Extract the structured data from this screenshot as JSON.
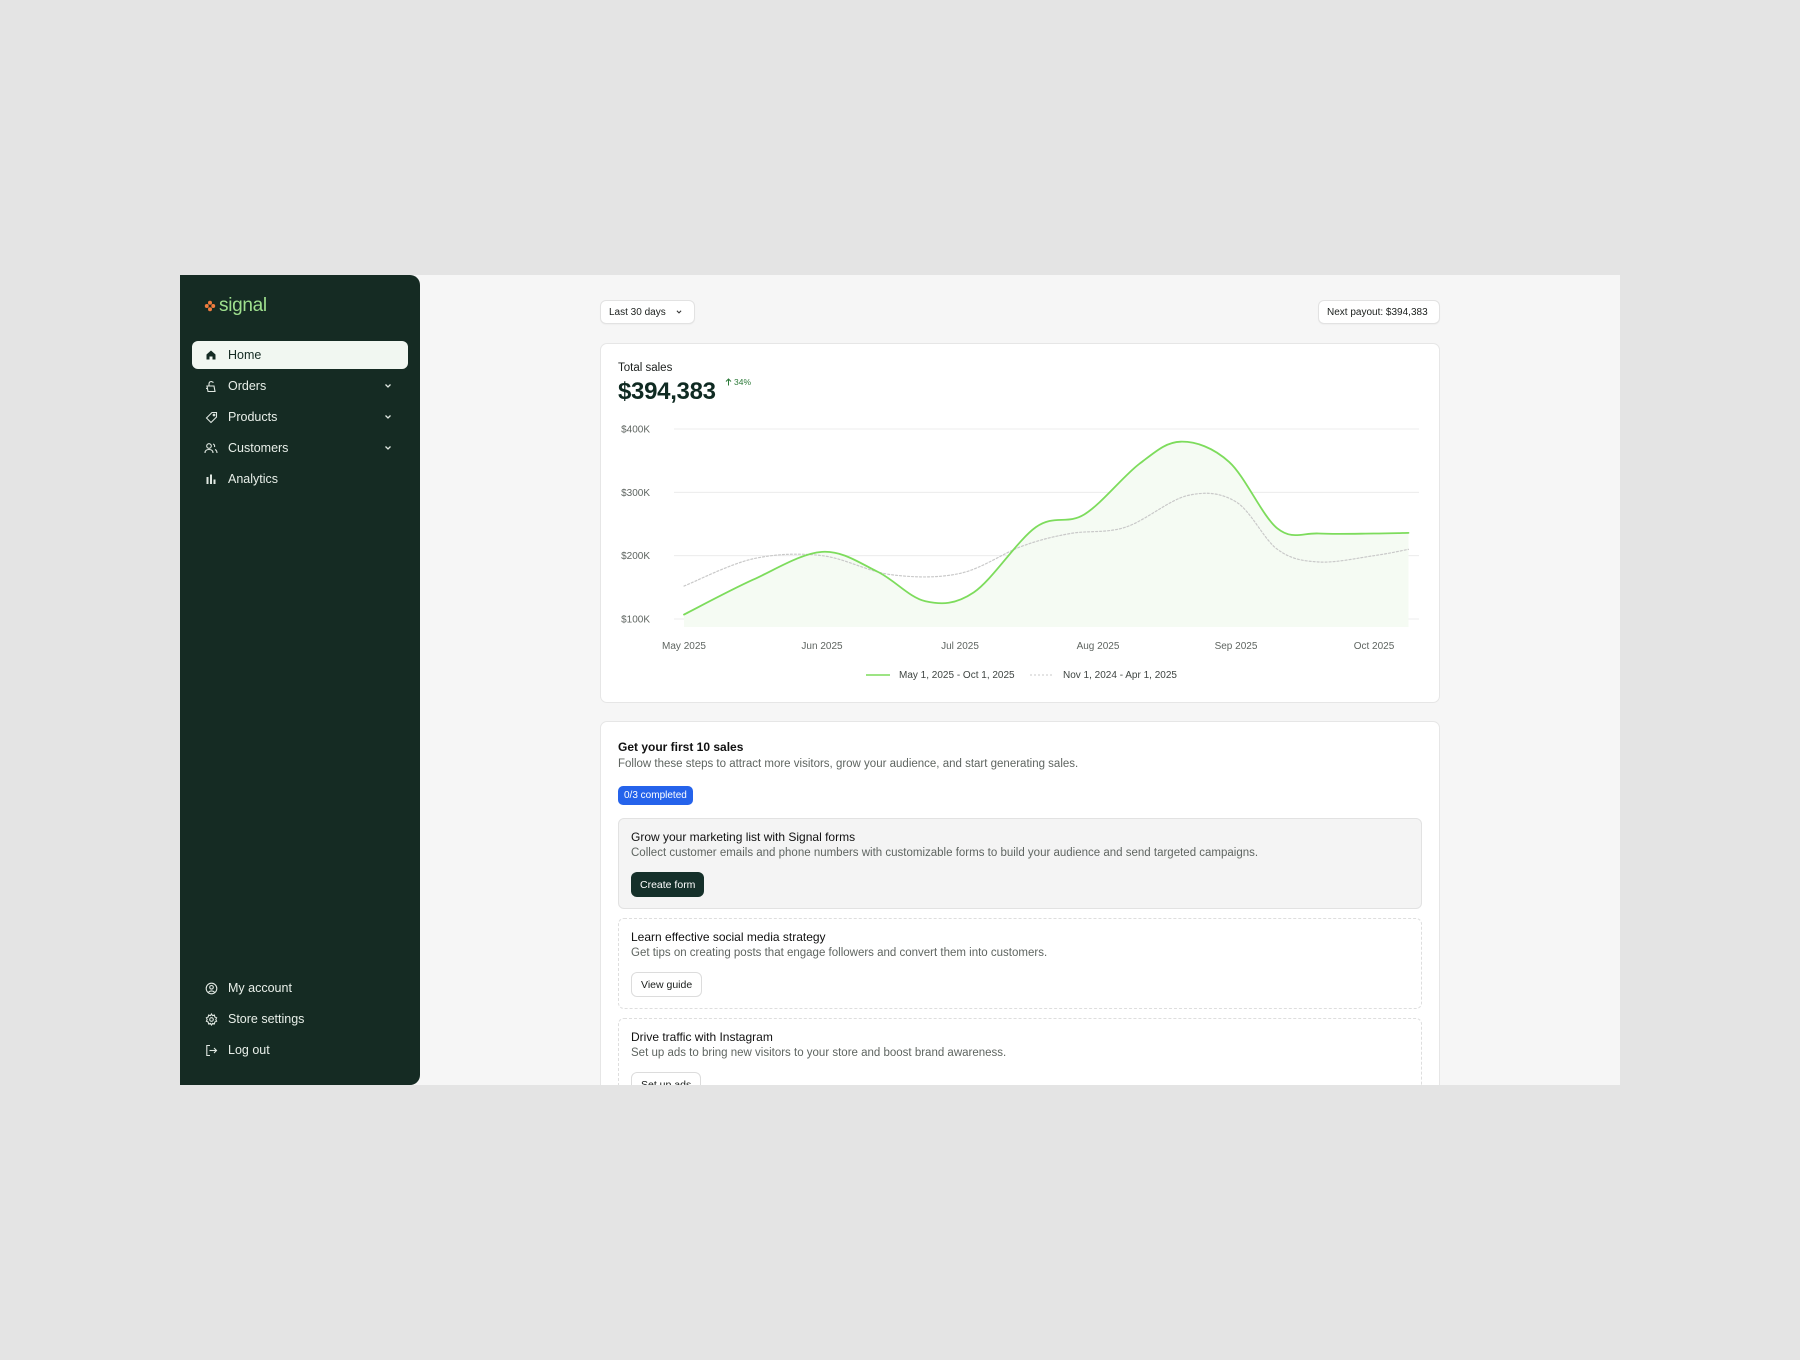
{
  "brand": {
    "name": "signal",
    "logo_icon": "flower-icon",
    "accent": "#f07c3e"
  },
  "sidebar": {
    "items": [
      {
        "label": "Home",
        "icon": "home-icon",
        "active": true
      },
      {
        "label": "Orders",
        "icon": "orders-icon",
        "expandable": true
      },
      {
        "label": "Products",
        "icon": "tag-icon",
        "expandable": true
      },
      {
        "label": "Customers",
        "icon": "users-icon",
        "expandable": true
      },
      {
        "label": "Analytics",
        "icon": "bar-chart-icon"
      }
    ],
    "bottom_items": [
      {
        "label": "My account",
        "icon": "user-circle-icon"
      },
      {
        "label": "Store settings",
        "icon": "gear-icon"
      },
      {
        "label": "Log out",
        "icon": "logout-icon"
      }
    ]
  },
  "toolbar": {
    "range_label": "Last 30 days",
    "payout_label": "Next payout: $394,383"
  },
  "sales": {
    "title": "Total sales",
    "value": "$394,383",
    "delta": "34%"
  },
  "chart_data": {
    "type": "line",
    "title": "Total sales",
    "categories": [
      "May 2025",
      "Jun 2025",
      "Jul 2025",
      "Aug 2025",
      "Sep 2025",
      "Oct 2025"
    ],
    "y_ticks": [
      "$400K",
      "$300K",
      "$200K",
      "$100K"
    ],
    "ylim": [
      100000,
      400000
    ],
    "grid": true,
    "legend_position": "bottom-center",
    "series": [
      {
        "name": "May 1, 2025 - Oct 1, 2025",
        "color": "#7ddc5c",
        "style": "solid",
        "points": [
          [
            0.0,
            107000
          ],
          [
            0.5,
            162000
          ],
          [
            1.0,
            206000
          ],
          [
            1.4,
            175000
          ],
          [
            1.75,
            128000
          ],
          [
            2.1,
            142000
          ],
          [
            2.55,
            245000
          ],
          [
            2.9,
            265000
          ],
          [
            3.3,
            345000
          ],
          [
            3.6,
            380000
          ],
          [
            3.95,
            348000
          ],
          [
            4.3,
            243000
          ],
          [
            4.6,
            235000
          ],
          [
            5.0,
            235000
          ],
          [
            5.25,
            236000
          ]
        ]
      },
      {
        "name": "Nov 1, 2024 - Apr 1, 2025",
        "color": "#c9c9c9",
        "style": "dotted",
        "points": [
          [
            0.0,
            152000
          ],
          [
            0.5,
            195000
          ],
          [
            1.0,
            200000
          ],
          [
            1.5,
            170000
          ],
          [
            2.0,
            172000
          ],
          [
            2.45,
            215000
          ],
          [
            2.8,
            235000
          ],
          [
            3.2,
            245000
          ],
          [
            3.65,
            295000
          ],
          [
            4.0,
            285000
          ],
          [
            4.3,
            210000
          ],
          [
            4.6,
            190000
          ],
          [
            5.0,
            200000
          ],
          [
            5.25,
            210000
          ]
        ]
      }
    ]
  },
  "onboarding": {
    "title": "Get your first 10 sales",
    "subtitle": "Follow these steps to attract more visitors, grow your audience, and start generating sales.",
    "badge": "0/3 completed",
    "steps": [
      {
        "title": "Grow your marketing list with Signal forms",
        "description": "Collect customer emails and phone numbers with customizable forms to build your audience and send targeted campaigns.",
        "button": "Create form"
      },
      {
        "title": "Learn effective social media strategy",
        "description": "Get tips on creating posts that engage followers and convert them into customers.",
        "button": "View guide"
      },
      {
        "title": "Drive traffic with Instagram",
        "description": "Set up ads to bring new visitors to your store and boost brand awareness.",
        "button": "Set up ads"
      }
    ]
  }
}
